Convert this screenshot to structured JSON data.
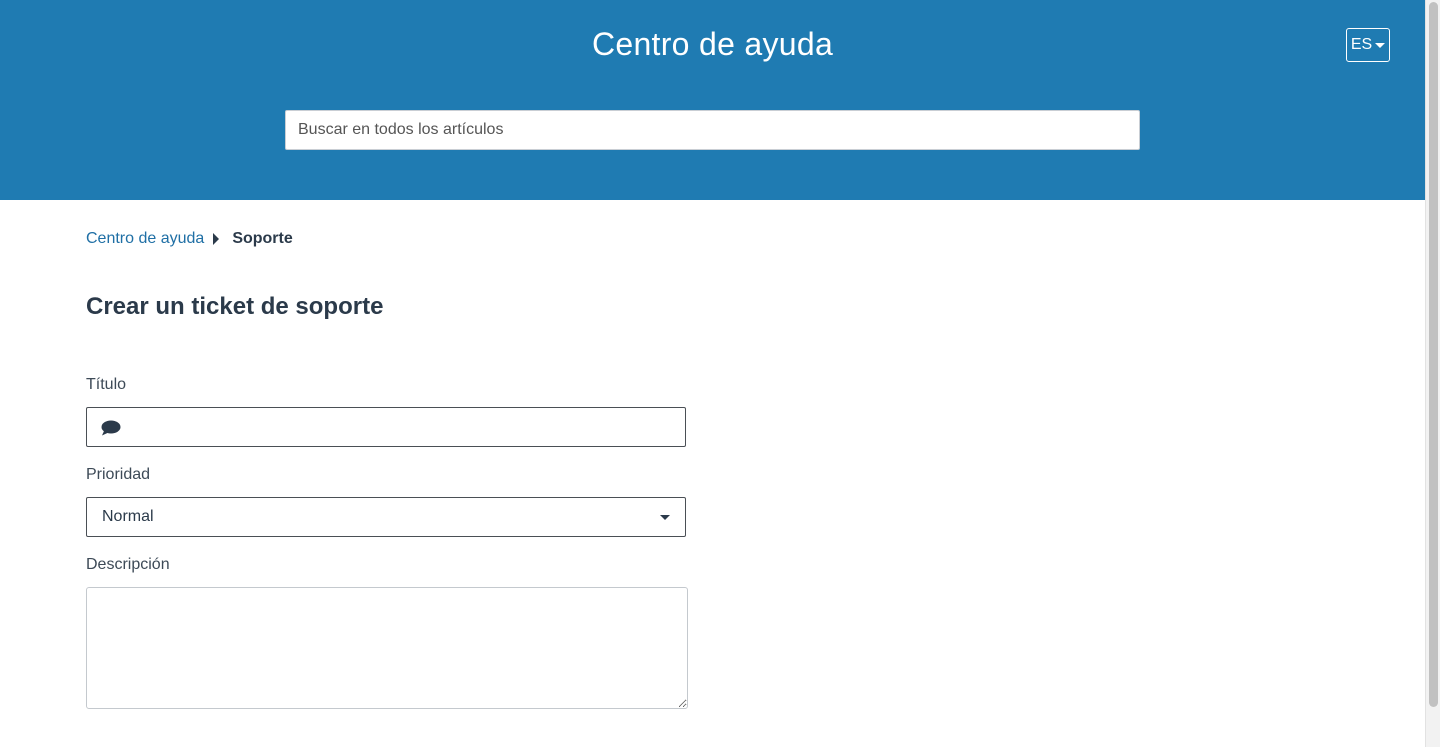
{
  "header": {
    "title": "Centro de ayuda",
    "language": "ES",
    "search_placeholder": "Buscar en todos los artículos",
    "background_color": "#1f7bb2"
  },
  "breadcrumb": {
    "home": "Centro de ayuda",
    "current": "Soporte"
  },
  "form": {
    "title": "Crear un ticket de soporte",
    "fields": {
      "title": {
        "label": "Título",
        "value": "",
        "icon": "speech-bubble-icon"
      },
      "priority": {
        "label": "Prioridad",
        "value": "Normal"
      },
      "description": {
        "label": "Descripción",
        "value": ""
      }
    }
  },
  "colors": {
    "link": "#1f6fa5",
    "text": "#2b3a4a"
  }
}
